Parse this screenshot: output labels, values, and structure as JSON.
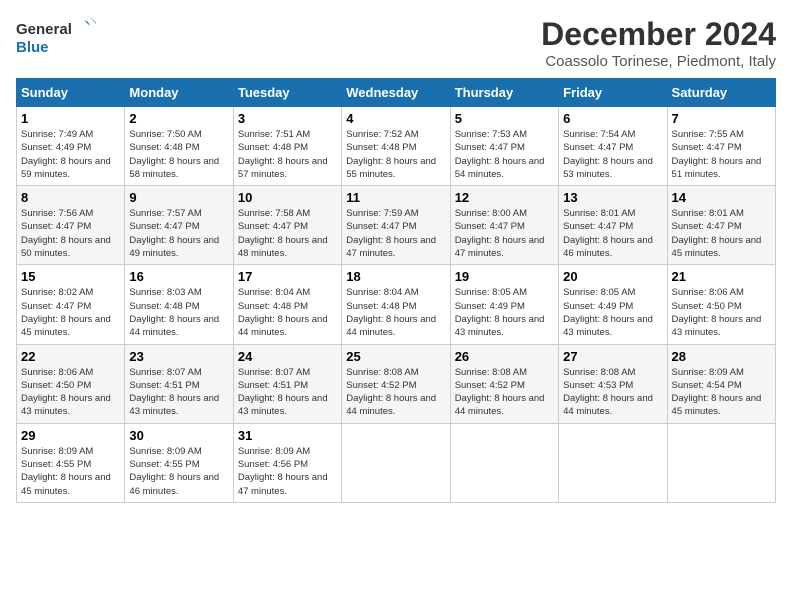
{
  "header": {
    "logo_line1": "General",
    "logo_line2": "Blue",
    "title": "December 2024",
    "subtitle": "Coassolo Torinese, Piedmont, Italy"
  },
  "weekdays": [
    "Sunday",
    "Monday",
    "Tuesday",
    "Wednesday",
    "Thursday",
    "Friday",
    "Saturday"
  ],
  "weeks": [
    [
      {
        "day": "1",
        "sunrise": "7:49 AM",
        "sunset": "4:49 PM",
        "daylight": "8 hours and 59 minutes."
      },
      {
        "day": "2",
        "sunrise": "7:50 AM",
        "sunset": "4:48 PM",
        "daylight": "8 hours and 58 minutes."
      },
      {
        "day": "3",
        "sunrise": "7:51 AM",
        "sunset": "4:48 PM",
        "daylight": "8 hours and 57 minutes."
      },
      {
        "day": "4",
        "sunrise": "7:52 AM",
        "sunset": "4:48 PM",
        "daylight": "8 hours and 55 minutes."
      },
      {
        "day": "5",
        "sunrise": "7:53 AM",
        "sunset": "4:47 PM",
        "daylight": "8 hours and 54 minutes."
      },
      {
        "day": "6",
        "sunrise": "7:54 AM",
        "sunset": "4:47 PM",
        "daylight": "8 hours and 53 minutes."
      },
      {
        "day": "7",
        "sunrise": "7:55 AM",
        "sunset": "4:47 PM",
        "daylight": "8 hours and 51 minutes."
      }
    ],
    [
      {
        "day": "8",
        "sunrise": "7:56 AM",
        "sunset": "4:47 PM",
        "daylight": "8 hours and 50 minutes."
      },
      {
        "day": "9",
        "sunrise": "7:57 AM",
        "sunset": "4:47 PM",
        "daylight": "8 hours and 49 minutes."
      },
      {
        "day": "10",
        "sunrise": "7:58 AM",
        "sunset": "4:47 PM",
        "daylight": "8 hours and 48 minutes."
      },
      {
        "day": "11",
        "sunrise": "7:59 AM",
        "sunset": "4:47 PM",
        "daylight": "8 hours and 47 minutes."
      },
      {
        "day": "12",
        "sunrise": "8:00 AM",
        "sunset": "4:47 PM",
        "daylight": "8 hours and 47 minutes."
      },
      {
        "day": "13",
        "sunrise": "8:01 AM",
        "sunset": "4:47 PM",
        "daylight": "8 hours and 46 minutes."
      },
      {
        "day": "14",
        "sunrise": "8:01 AM",
        "sunset": "4:47 PM",
        "daylight": "8 hours and 45 minutes."
      }
    ],
    [
      {
        "day": "15",
        "sunrise": "8:02 AM",
        "sunset": "4:47 PM",
        "daylight": "8 hours and 45 minutes."
      },
      {
        "day": "16",
        "sunrise": "8:03 AM",
        "sunset": "4:48 PM",
        "daylight": "8 hours and 44 minutes."
      },
      {
        "day": "17",
        "sunrise": "8:04 AM",
        "sunset": "4:48 PM",
        "daylight": "8 hours and 44 minutes."
      },
      {
        "day": "18",
        "sunrise": "8:04 AM",
        "sunset": "4:48 PM",
        "daylight": "8 hours and 44 minutes."
      },
      {
        "day": "19",
        "sunrise": "8:05 AM",
        "sunset": "4:49 PM",
        "daylight": "8 hours and 43 minutes."
      },
      {
        "day": "20",
        "sunrise": "8:05 AM",
        "sunset": "4:49 PM",
        "daylight": "8 hours and 43 minutes."
      },
      {
        "day": "21",
        "sunrise": "8:06 AM",
        "sunset": "4:50 PM",
        "daylight": "8 hours and 43 minutes."
      }
    ],
    [
      {
        "day": "22",
        "sunrise": "8:06 AM",
        "sunset": "4:50 PM",
        "daylight": "8 hours and 43 minutes."
      },
      {
        "day": "23",
        "sunrise": "8:07 AM",
        "sunset": "4:51 PM",
        "daylight": "8 hours and 43 minutes."
      },
      {
        "day": "24",
        "sunrise": "8:07 AM",
        "sunset": "4:51 PM",
        "daylight": "8 hours and 43 minutes."
      },
      {
        "day": "25",
        "sunrise": "8:08 AM",
        "sunset": "4:52 PM",
        "daylight": "8 hours and 44 minutes."
      },
      {
        "day": "26",
        "sunrise": "8:08 AM",
        "sunset": "4:52 PM",
        "daylight": "8 hours and 44 minutes."
      },
      {
        "day": "27",
        "sunrise": "8:08 AM",
        "sunset": "4:53 PM",
        "daylight": "8 hours and 44 minutes."
      },
      {
        "day": "28",
        "sunrise": "8:09 AM",
        "sunset": "4:54 PM",
        "daylight": "8 hours and 45 minutes."
      }
    ],
    [
      {
        "day": "29",
        "sunrise": "8:09 AM",
        "sunset": "4:55 PM",
        "daylight": "8 hours and 45 minutes."
      },
      {
        "day": "30",
        "sunrise": "8:09 AM",
        "sunset": "4:55 PM",
        "daylight": "8 hours and 46 minutes."
      },
      {
        "day": "31",
        "sunrise": "8:09 AM",
        "sunset": "4:56 PM",
        "daylight": "8 hours and 47 minutes."
      },
      null,
      null,
      null,
      null
    ]
  ]
}
